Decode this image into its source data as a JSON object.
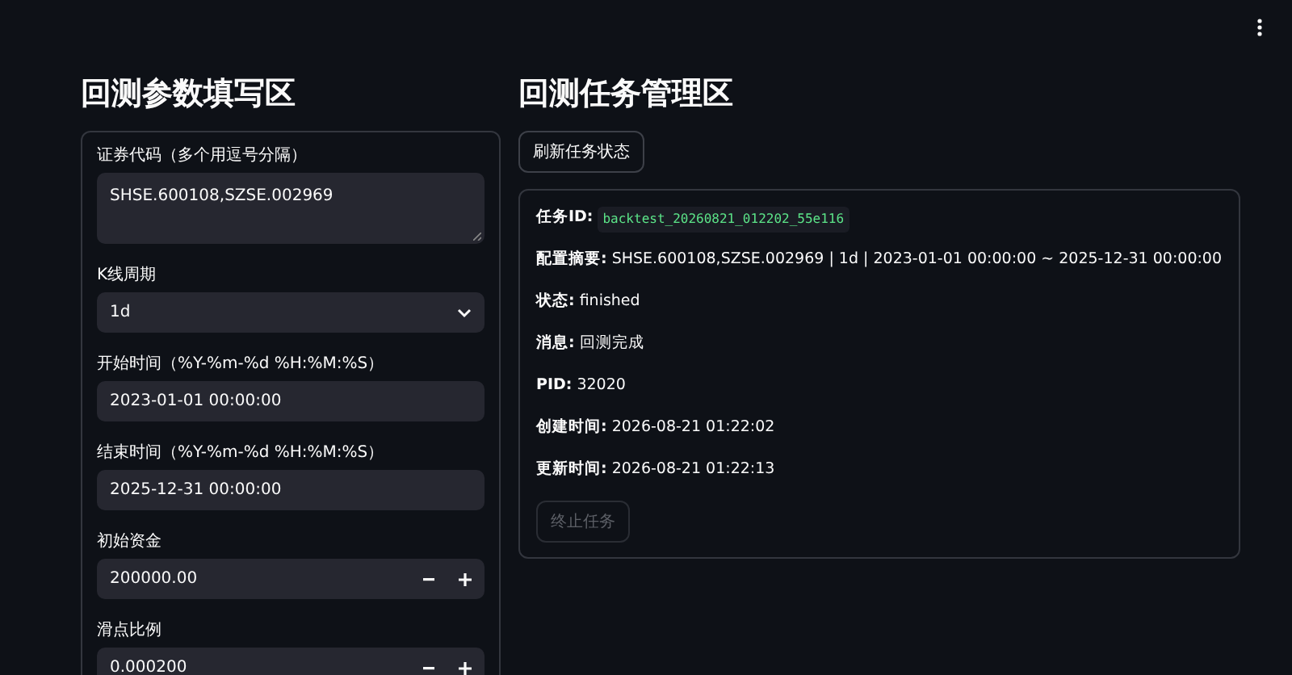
{
  "left": {
    "title": "回测参数填写区",
    "fields": [
      {
        "kind": "textarea",
        "label": "证券代码（多个用逗号分隔）",
        "value": "SHSE.600108,SZSE.002969"
      },
      {
        "kind": "select",
        "label": "K线周期",
        "value": "1d"
      },
      {
        "kind": "text",
        "label": "开始时间（%Y-%m-%d %H:%M:%S）",
        "value": "2023-01-01 00:00:00"
      },
      {
        "kind": "text",
        "label": "结束时间（%Y-%m-%d %H:%M:%S）",
        "value": "2025-12-31 00:00:00"
      },
      {
        "kind": "number",
        "label": "初始资金",
        "value": "200000.00"
      },
      {
        "kind": "number",
        "label": "滑点比例",
        "value": "0.000200"
      }
    ]
  },
  "right": {
    "title": "回测任务管理区",
    "refresh_button": "刷新任务状态",
    "details": [
      {
        "kind": "code",
        "label": "任务ID:",
        "value": "backtest_20260821_012202_55e116"
      },
      {
        "kind": "text",
        "label": "配置摘要:",
        "value": "SHSE.600108,SZSE.002969 | 1d | 2023-01-01 00:00:00 ~ 2025-12-31 00:00:00"
      },
      {
        "kind": "text",
        "label": "状态:",
        "value": "finished"
      },
      {
        "kind": "text",
        "label": "消息:",
        "value": "回测完成"
      },
      {
        "kind": "text",
        "label": "PID:",
        "value": "32020"
      },
      {
        "kind": "text",
        "label": "创建时间:",
        "value": "2026-08-21 01:22:02"
      },
      {
        "kind": "text",
        "label": "更新时间:",
        "value": "2026-08-21 01:22:13"
      }
    ],
    "stop_button": {
      "label": "终止任务",
      "disabled": true
    }
  }
}
